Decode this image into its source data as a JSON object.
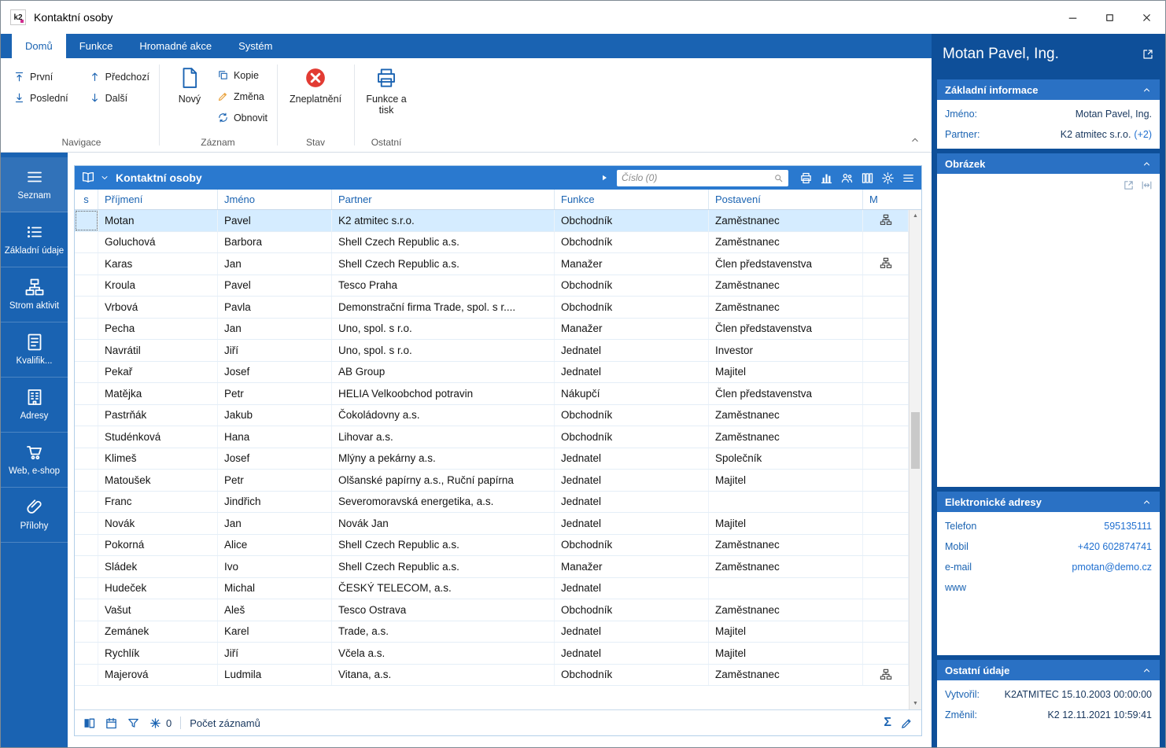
{
  "window": {
    "title": "Kontaktní osoby",
    "app_icon_text": "k2"
  },
  "colors": {
    "primary_blue": "#1a63b2",
    "grid_header_blue": "#2a79cf",
    "panel_dark_blue": "#0e4f99",
    "section_blue": "#2a71c4",
    "selected_row": "#d5ecff",
    "danger_red": "#e23b33",
    "pencil_orange": "#e9a13b"
  },
  "ribbon": {
    "tabs": [
      {
        "label": "Domů",
        "active": true
      },
      {
        "label": "Funkce",
        "active": false
      },
      {
        "label": "Hromadné akce",
        "active": false
      },
      {
        "label": "Systém",
        "active": false
      }
    ],
    "groups": {
      "navigace": {
        "label": "Navigace",
        "prvni": "První",
        "predchozi": "Předchozí",
        "posledni": "Poslední",
        "dalsi": "Další"
      },
      "zaznam": {
        "label": "Záznam",
        "novy": "Nový",
        "kopie": "Kopie",
        "zmena": "Změna",
        "obnovit": "Obnovit"
      },
      "stav": {
        "label": "Stav",
        "zneplatneni": "Zneplatnění"
      },
      "ostatni": {
        "label": "Ostatní",
        "funkce_a_tisk": "Funkce a tisk"
      }
    }
  },
  "sidebar": {
    "items": [
      {
        "label": "Seznam",
        "icon": "menu-icon",
        "active": true
      },
      {
        "label": "Základní údaje",
        "icon": "list-icon",
        "active": false
      },
      {
        "label": "Strom aktivit",
        "icon": "tree-icon",
        "active": false
      },
      {
        "label": "Kvalifik...",
        "icon": "doc-icon",
        "active": false
      },
      {
        "label": "Adresy",
        "icon": "building-icon",
        "active": false
      },
      {
        "label": "Web, e-shop",
        "icon": "cart-icon",
        "active": false
      },
      {
        "label": "Přílohy",
        "icon": "paperclip-icon",
        "active": false
      }
    ]
  },
  "grid": {
    "view_title": "Kontaktní osoby",
    "search": {
      "placeholder": "Číslo (0)"
    },
    "columns": [
      "s",
      "Příjmení",
      "Jméno",
      "Partner",
      "Funkce",
      "Postavení",
      "M"
    ],
    "rows": [
      {
        "prijmeni": "Motan",
        "jmeno": "Pavel",
        "partner": "K2 atmitec s.r.o.",
        "funkce": "Obchodník",
        "postaveni": "Zaměstnanec",
        "m": true,
        "selected": true
      },
      {
        "prijmeni": "Goluchová",
        "jmeno": "Barbora",
        "partner": "Shell Czech Republic a.s.",
        "funkce": "Obchodník",
        "postaveni": "Zaměstnanec",
        "m": false,
        "selected": false
      },
      {
        "prijmeni": "Karas",
        "jmeno": "Jan",
        "partner": "Shell Czech Republic a.s.",
        "funkce": "Manažer",
        "postaveni": "Člen představenstva",
        "m": true,
        "selected": false
      },
      {
        "prijmeni": "Kroula",
        "jmeno": "Pavel",
        "partner": "Tesco Praha",
        "funkce": "Obchodník",
        "postaveni": "Zaměstnanec",
        "m": false,
        "selected": false
      },
      {
        "prijmeni": "Vrbová",
        "jmeno": "Pavla",
        "partner": "Demonstrační firma Trade, spol. s r....",
        "funkce": "Obchodník",
        "postaveni": "Zaměstnanec",
        "m": false,
        "selected": false
      },
      {
        "prijmeni": "Pecha",
        "jmeno": "Jan",
        "partner": "Uno, spol. s r.o.",
        "funkce": "Manažer",
        "postaveni": "Člen představenstva",
        "m": false,
        "selected": false
      },
      {
        "prijmeni": "Navrátil",
        "jmeno": "Jiří",
        "partner": "Uno, spol. s r.o.",
        "funkce": "Jednatel",
        "postaveni": "Investor",
        "m": false,
        "selected": false
      },
      {
        "prijmeni": "Pekař",
        "jmeno": "Josef",
        "partner": "AB Group",
        "funkce": "Jednatel",
        "postaveni": "Majitel",
        "m": false,
        "selected": false
      },
      {
        "prijmeni": "Matějka",
        "jmeno": "Petr",
        "partner": "HELIA Velkoobchod potravin",
        "funkce": "Nákupčí",
        "postaveni": "Člen představenstva",
        "m": false,
        "selected": false
      },
      {
        "prijmeni": "Pastrňák",
        "jmeno": "Jakub",
        "partner": "Čokoládovny a.s.",
        "funkce": "Obchodník",
        "postaveni": "Zaměstnanec",
        "m": false,
        "selected": false
      },
      {
        "prijmeni": "Studénková",
        "jmeno": "Hana",
        "partner": "Lihovar a.s.",
        "funkce": "Obchodník",
        "postaveni": "Zaměstnanec",
        "m": false,
        "selected": false
      },
      {
        "prijmeni": "Klimeš",
        "jmeno": "Josef",
        "partner": "Mlýny a pekárny a.s.",
        "funkce": "Jednatel",
        "postaveni": "Společník",
        "m": false,
        "selected": false
      },
      {
        "prijmeni": "Matoušek",
        "jmeno": "Petr",
        "partner": "Olšanské papírny a.s., Ruční papírna",
        "funkce": "Jednatel",
        "postaveni": "Majitel",
        "m": false,
        "selected": false
      },
      {
        "prijmeni": "Franc",
        "jmeno": "Jindřich",
        "partner": "Severomoravská energetika, a.s.",
        "funkce": "Jednatel",
        "postaveni": "",
        "m": false,
        "selected": false
      },
      {
        "prijmeni": "Novák",
        "jmeno": "Jan",
        "partner": "Novák Jan",
        "funkce": "Jednatel",
        "postaveni": "Majitel",
        "m": false,
        "selected": false
      },
      {
        "prijmeni": "Pokorná",
        "jmeno": "Alice",
        "partner": "Shell Czech Republic a.s.",
        "funkce": "Obchodník",
        "postaveni": "Zaměstnanec",
        "m": false,
        "selected": false
      },
      {
        "prijmeni": "Sládek",
        "jmeno": "Ivo",
        "partner": "Shell Czech Republic a.s.",
        "funkce": "Manažer",
        "postaveni": "Zaměstnanec",
        "m": false,
        "selected": false
      },
      {
        "prijmeni": "Hudeček",
        "jmeno": "Michal",
        "partner": "ČESKÝ TELECOM, a.s.",
        "funkce": "Jednatel",
        "postaveni": "",
        "m": false,
        "selected": false
      },
      {
        "prijmeni": "Vašut",
        "jmeno": "Aleš",
        "partner": "Tesco Ostrava",
        "funkce": "Obchodník",
        "postaveni": "Zaměstnanec",
        "m": false,
        "selected": false
      },
      {
        "prijmeni": "Zemánek",
        "jmeno": "Karel",
        "partner": "Trade, a.s.",
        "funkce": "Jednatel",
        "postaveni": "Majitel",
        "m": false,
        "selected": false
      },
      {
        "prijmeni": "Rychlík",
        "jmeno": "Jiří",
        "partner": "Včela a.s.",
        "funkce": "Jednatel",
        "postaveni": "Majitel",
        "m": false,
        "selected": false
      },
      {
        "prijmeni": "Majerová",
        "jmeno": "Ludmila",
        "partner": "Vitana, a.s.",
        "funkce": "Obchodník",
        "postaveni": "Zaměstnanec",
        "m": true,
        "selected": false
      }
    ]
  },
  "statusbar": {
    "frozen_count": "0",
    "records_label": "Počet záznamů",
    "sum_icon_glyph": "Σ"
  },
  "detail_panel": {
    "title": "Motan Pavel, Ing.",
    "sections": {
      "zakladni": {
        "title": "Základní informace",
        "jmeno_label": "Jméno:",
        "jmeno_value": "Motan Pavel, Ing.",
        "partner_label": "Partner:",
        "partner_value": "K2 atmitec s.r.o.",
        "partner_extra": "(+2)"
      },
      "obrazek": {
        "title": "Obrázek"
      },
      "adresy": {
        "title": "Elektronické adresy",
        "rows": [
          {
            "label": "Telefon",
            "value": "595135111"
          },
          {
            "label": "Mobil",
            "value": "+420 602874741"
          },
          {
            "label": "e-mail",
            "value": "pmotan@demo.cz"
          },
          {
            "label": "www",
            "value": ""
          }
        ]
      },
      "ostatni": {
        "title": "Ostatní údaje",
        "rows": [
          {
            "label": "Vytvořil:",
            "value": "K2ATMITEC 15.10.2003 00:00:00"
          },
          {
            "label": "Změnil:",
            "value": "K2 12.11.2021 10:59:41"
          }
        ]
      }
    }
  }
}
